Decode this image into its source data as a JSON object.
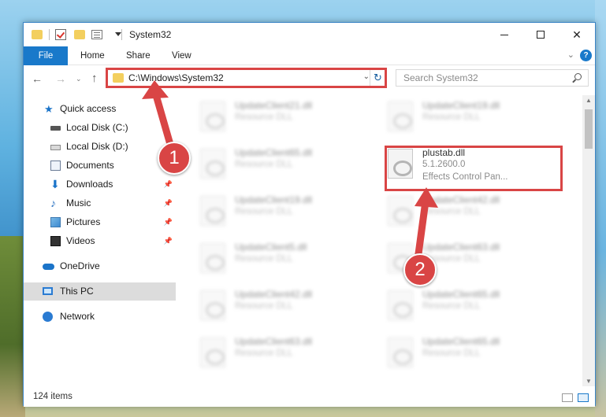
{
  "window": {
    "title": "System32"
  },
  "ribbon": {
    "tabs": [
      "File",
      "Home",
      "Share",
      "View"
    ]
  },
  "address": {
    "path": "C:\\Windows\\System32"
  },
  "search": {
    "placeholder": "Search System32"
  },
  "sidebar": {
    "items": [
      {
        "label": "Quick access",
        "icon": "quick-access-star-icon"
      },
      {
        "label": "Local Disk (C:)",
        "icon": "drive-icon"
      },
      {
        "label": "Local Disk (D:)",
        "icon": "drive-icon"
      },
      {
        "label": "Documents",
        "icon": "documents-icon"
      },
      {
        "label": "Downloads",
        "icon": "downloads-icon",
        "pinned": true
      },
      {
        "label": "Music",
        "icon": "music-icon",
        "pinned": true
      },
      {
        "label": "Pictures",
        "icon": "pictures-icon",
        "pinned": true
      },
      {
        "label": "Videos",
        "icon": "videos-icon",
        "pinned": true
      },
      {
        "label": "OneDrive",
        "icon": "onedrive-cloud-icon"
      },
      {
        "label": "This PC",
        "icon": "this-pc-icon",
        "selected": true
      },
      {
        "label": "Network",
        "icon": "network-icon"
      }
    ]
  },
  "files": [
    {
      "name": "UpdateClient21.dll",
      "type": "Resource DLL"
    },
    {
      "name": "UpdateClient19.dll",
      "type": "Resource DLL"
    },
    {
      "name": "UpdateClient65.dll",
      "type": "Resource DLL"
    },
    {
      "name": "plustab.dll",
      "version": "5.1.2600.0",
      "description": "Effects Control Pan..."
    },
    {
      "name": "UpdateClient19.dll",
      "type": "Resource DLL"
    },
    {
      "name": "UpdateClient42.dll",
      "type": "Resource DLL"
    },
    {
      "name": "UpdateClient5.dll",
      "type": "Resource DLL"
    },
    {
      "name": "UpdateClient63.dll",
      "type": "Resource DLL"
    },
    {
      "name": "UpdateClient42.dll",
      "type": "Resource DLL"
    },
    {
      "name": "UpdateClient65.dll",
      "type": "Resource DLL"
    },
    {
      "name": "UpdateClient63.dll",
      "type": "Resource DLL"
    },
    {
      "name": "UpdateClient65.dll",
      "type": "Resource DLL"
    }
  ],
  "status": {
    "item_count": "124 items"
  },
  "steps": [
    "1",
    "2"
  ],
  "colors": {
    "accent": "#1979ca",
    "highlight": "#d94545"
  }
}
